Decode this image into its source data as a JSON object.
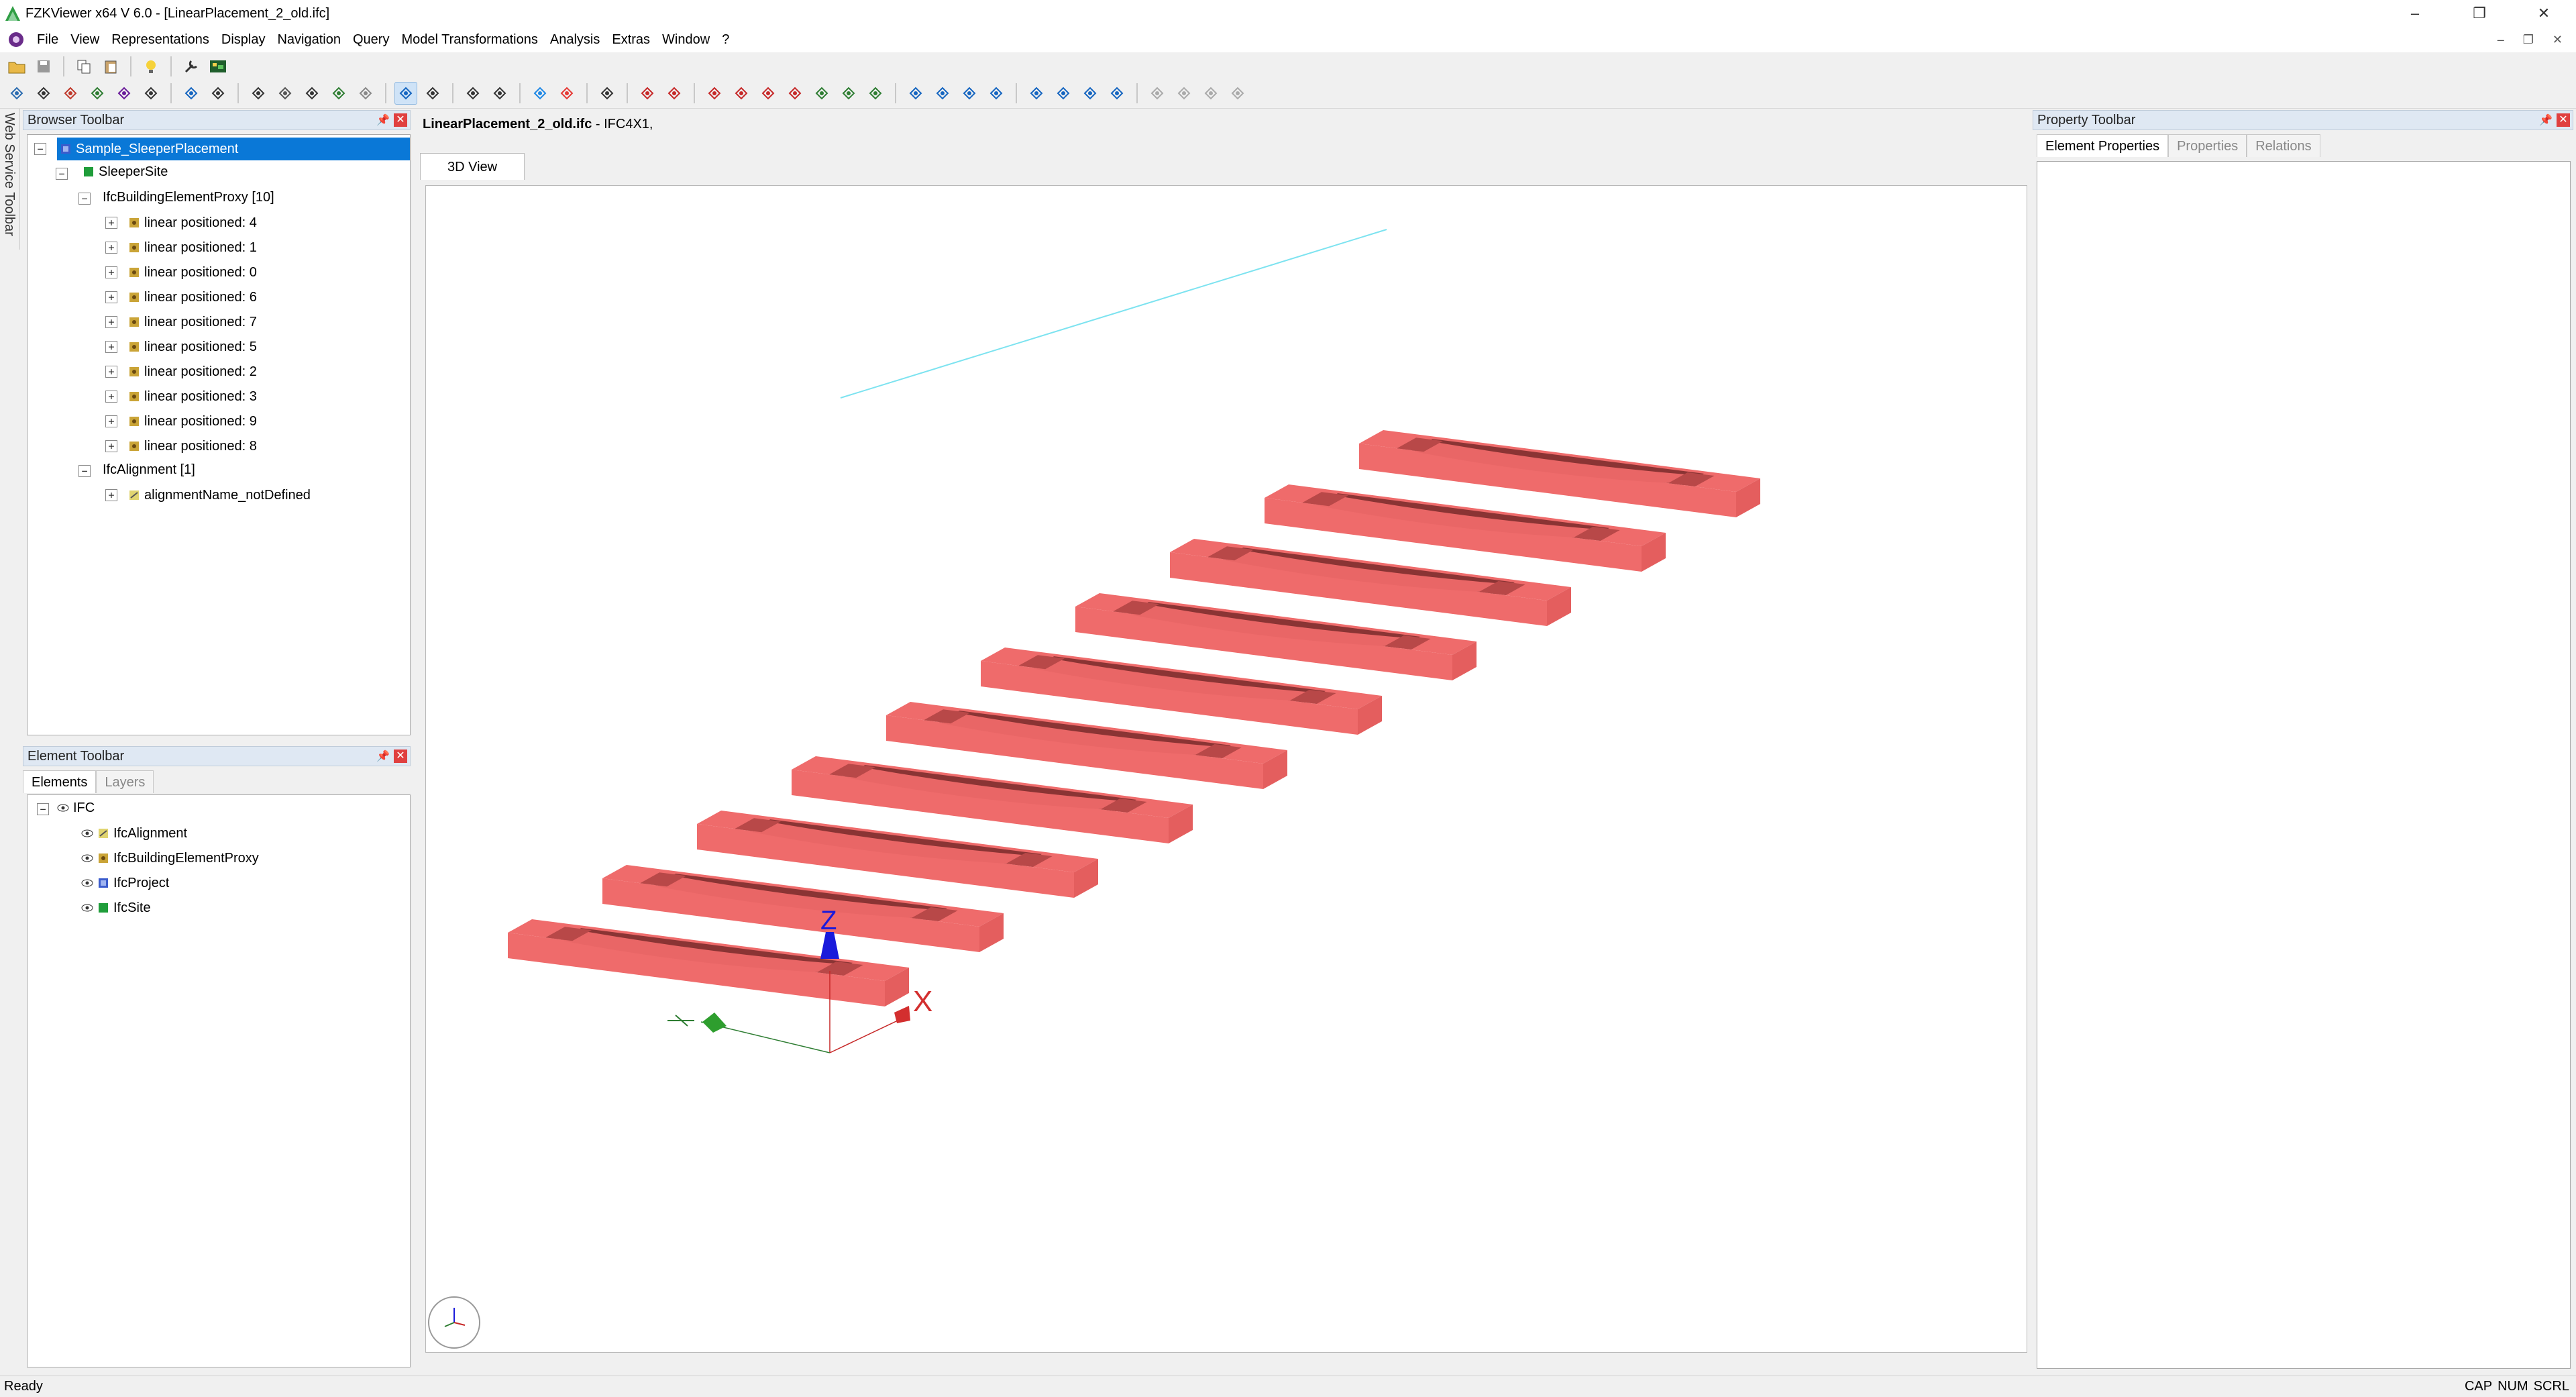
{
  "window": {
    "title": "FZKViewer x64 V 6.0 - [LinearPlacement_2_old.ifc]"
  },
  "menu": [
    "File",
    "View",
    "Representations",
    "Display",
    "Navigation",
    "Query",
    "Model Transformations",
    "Analysis",
    "Extras",
    "Window",
    "?"
  ],
  "side_tab": {
    "label": "Web Service Toolbar"
  },
  "browser": {
    "title": "Browser Toolbar",
    "root": "Sample_SleeperPlacement",
    "site": "SleeperSite",
    "group_proxy": "IfcBuildingElementProxy [10]",
    "items": [
      "linear positioned: 4",
      "linear positioned: 1",
      "linear positioned: 0",
      "linear positioned: 6",
      "linear positioned: 7",
      "linear positioned: 5",
      "linear positioned: 2",
      "linear positioned: 3",
      "linear positioned: 9",
      "linear positioned: 8"
    ],
    "group_alignment": "IfcAlignment [1]",
    "alignment_item": "alignmentName_notDefined"
  },
  "element": {
    "title": "Element Toolbar",
    "tabs": [
      "Elements",
      "Layers"
    ],
    "root": "IFC",
    "items": [
      "IfcAlignment",
      "IfcBuildingElementProxy",
      "IfcProject",
      "IfcSite"
    ]
  },
  "document": {
    "filename": "LinearPlacement_2_old.ifc",
    "schema": " - IFC4X1,",
    "view_tab": "3D View"
  },
  "axes": {
    "x": "X",
    "z": "Z"
  },
  "property": {
    "title": "Property Toolbar",
    "tabs": [
      "Element Properties",
      "Properties",
      "Relations"
    ]
  },
  "status": {
    "left": "Ready",
    "indicators": [
      "CAP",
      "NUM",
      "SCRL"
    ]
  },
  "colors": {
    "sleeper": "#ef6b6b",
    "sleeper_dark": "#8a3434",
    "selection": "#0a78d7",
    "alignment_line": "#7de3f0"
  }
}
